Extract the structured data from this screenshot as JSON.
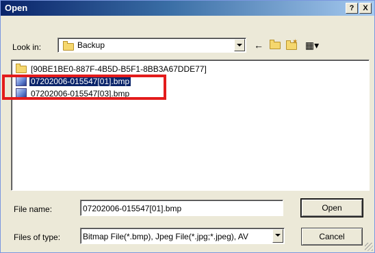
{
  "window": {
    "title": "Open",
    "help_btn": "?",
    "close_btn": "X"
  },
  "lookin": {
    "label": "Look in:",
    "value": "Backup"
  },
  "toolbar": {
    "icons": [
      "back-icon",
      "up-folder-icon",
      "new-folder-icon",
      "view-menu-icon"
    ]
  },
  "files": [
    {
      "name": "[90BE1BE0-887F-4B5D-B5F1-8BB3A67DDE77]",
      "type": "folder",
      "selected": false
    },
    {
      "name": "07202006-015547[01].bmp",
      "type": "bitmap",
      "selected": true
    },
    {
      "name": "07202006-015547[03].bmp",
      "type": "bitmap",
      "selected": false
    }
  ],
  "filename": {
    "label": "File name:",
    "value": "07202006-015547[01].bmp"
  },
  "filetype": {
    "label": "Files of type:",
    "value": "Bitmap File(*.bmp), Jpeg File(*.jpg;*.jpeg), AV"
  },
  "buttons": {
    "open": "Open",
    "cancel": "Cancel"
  },
  "colors": {
    "selection": "#0a246a",
    "annotation": "#e31b1b",
    "dialog_bg": "#ece9d8"
  }
}
